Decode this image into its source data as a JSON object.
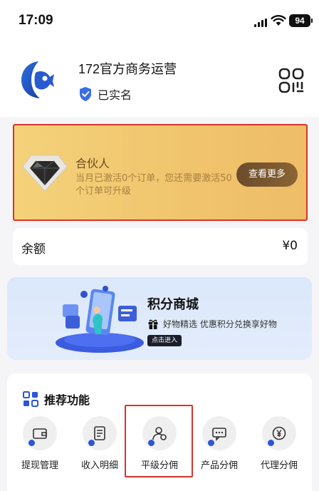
{
  "status_bar": {
    "time": "17:09",
    "battery": "94"
  },
  "profile": {
    "name": "172官方商务运营",
    "verified_label": "已实名"
  },
  "partner": {
    "title": "合伙人",
    "description": "当月已激活0个订单，您还需要激活50个订单可升级",
    "button": "查看更多"
  },
  "balance": {
    "label": "余额",
    "value": "¥0"
  },
  "mall": {
    "title": "积分商城",
    "subtitle": "好物精选 优惠积分兑换享好物",
    "enter": "点击进入"
  },
  "recommended": {
    "title": "推荐功能",
    "items": [
      {
        "label": "提现管理",
        "icon": "wallet-icon"
      },
      {
        "label": "收入明细",
        "icon": "document-icon"
      },
      {
        "label": "平级分佣",
        "icon": "user-badge-icon"
      },
      {
        "label": "产品分佣",
        "icon": "chat-icon"
      },
      {
        "label": "代理分佣",
        "icon": "yen-coin-icon"
      }
    ]
  },
  "colors": {
    "accent": "#2d55d8",
    "highlight": "#d8332b",
    "partner_gold": "#f0c46d",
    "button_brown": "#6a4b2c"
  }
}
